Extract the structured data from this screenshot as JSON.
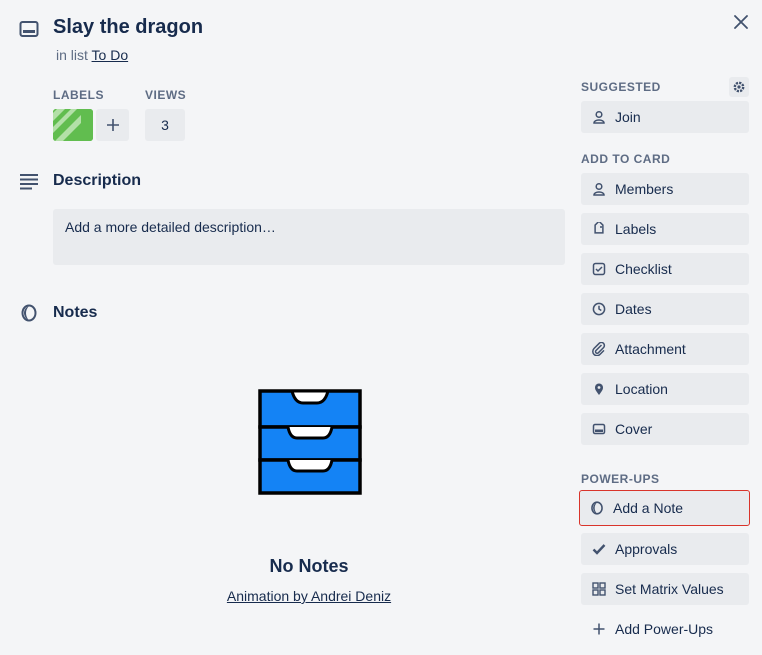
{
  "card": {
    "title": "Slay the dragon",
    "list_prefix": "in list",
    "list_name": "To Do"
  },
  "labels": {
    "heading": "LABELS",
    "label_color": "#61bd4f",
    "add_symbol": "+"
  },
  "views": {
    "heading": "VIEWS",
    "count": "3"
  },
  "description": {
    "heading": "Description",
    "placeholder": "Add a more detailed description…"
  },
  "notes": {
    "heading": "Notes",
    "empty_title": "No Notes",
    "credit": "Animation by Andrei Deniz",
    "drawer_color": "#1483f5"
  },
  "sidebar": {
    "suggested_heading": "SUGGESTED",
    "suggested": [
      {
        "label": "Join",
        "icon": "person-icon"
      }
    ],
    "add_heading": "ADD TO CARD",
    "add_items": [
      {
        "label": "Members",
        "icon": "person-icon"
      },
      {
        "label": "Labels",
        "icon": "tag-icon"
      },
      {
        "label": "Checklist",
        "icon": "checkbox-icon"
      },
      {
        "label": "Dates",
        "icon": "clock-icon"
      },
      {
        "label": "Attachment",
        "icon": "paperclip-icon"
      },
      {
        "label": "Location",
        "icon": "pin-icon"
      },
      {
        "label": "Cover",
        "icon": "cover-icon"
      }
    ],
    "powerups_heading": "POWER-UPS",
    "powerups": [
      {
        "label": "Add a Note",
        "icon": "note-icon"
      },
      {
        "label": "Approvals",
        "icon": "check-icon"
      },
      {
        "label": "Set Matrix Values",
        "icon": "grid-icon"
      },
      {
        "label": "Add Power-Ups",
        "icon": "plus-icon"
      }
    ],
    "highlight_color": "#d9342b"
  }
}
